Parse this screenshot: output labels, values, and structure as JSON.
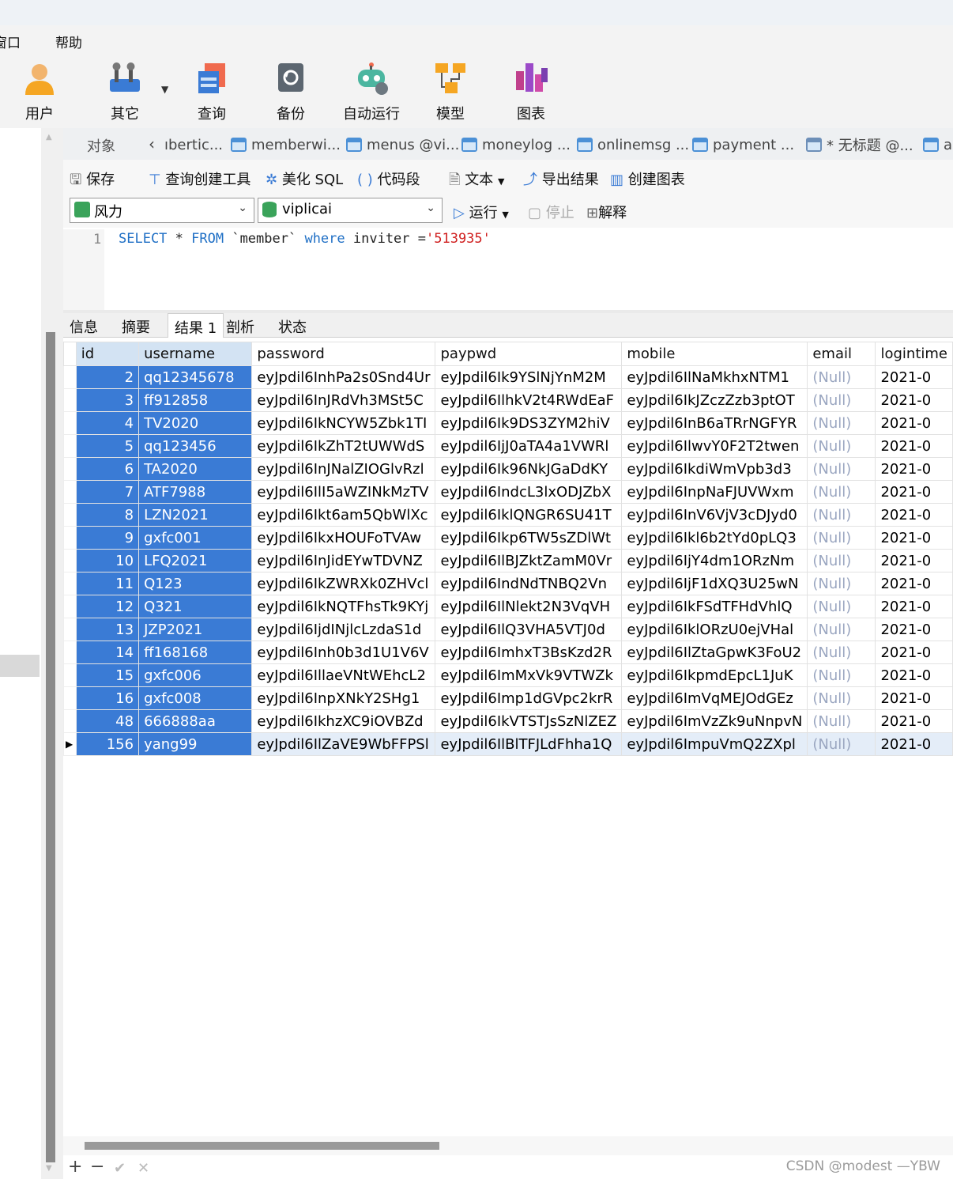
{
  "menu": {
    "window_partial": "窗口",
    "help": "帮助"
  },
  "ribbon": [
    {
      "label": "用户",
      "icon": "user-icon"
    },
    {
      "label": "其它",
      "icon": "tools-icon"
    },
    {
      "label": "查询",
      "icon": "query-icon"
    },
    {
      "label": "备份",
      "icon": "backup-icon"
    },
    {
      "label": "自动运行",
      "icon": "robot-icon"
    },
    {
      "label": "模型",
      "icon": "model-icon"
    },
    {
      "label": "图表",
      "icon": "chart-icon"
    }
  ],
  "tabs": {
    "objects": "对象",
    "items": [
      "ıbertic...",
      "memberwi...",
      "menus @vi...",
      "moneylog ...",
      "onlinemsg ...",
      "payment ...",
      "* 无标题 @...",
      "ac"
    ]
  },
  "toolbar1": {
    "save": "保存",
    "query_builder": "查询创建工具",
    "beautify": "美化 SQL",
    "snippet": "代码段",
    "text": "文本",
    "export": "导出结果",
    "create_chart": "创建图表"
  },
  "toolbar2": {
    "connection": "风力",
    "database": "viplicai",
    "run": "运行",
    "stop": "停止",
    "explain": "解释"
  },
  "editor": {
    "line": "1",
    "sql_select": "SELECT",
    "sql_star": " * ",
    "sql_from": "FROM",
    "sql_table": " `member` ",
    "sql_where": "where",
    "sql_cond": " inviter =",
    "sql_value": "'513935'"
  },
  "result_tabs": [
    "信息",
    "摘要",
    "结果 1",
    "剖析",
    "状态"
  ],
  "grid": {
    "columns": [
      "id",
      "username",
      "password",
      "paypwd",
      "mobile",
      "email",
      "logintime"
    ],
    "rows": [
      [
        "2",
        "qq12345678",
        "eyJpdil6InhPa2s0Snd4Ur",
        "eyJpdil6Ik9YSlNjYnM2M",
        "eyJpdil6IlNaMkhxNTM1",
        "(Null)",
        "2021-0"
      ],
      [
        "3",
        "ff912858",
        "eyJpdil6InJRdVh3MSt5C",
        "eyJpdil6IlhkV2t4RWdEaF",
        "eyJpdil6IkJZczZzb3ptOT",
        "(Null)",
        "2021-0"
      ],
      [
        "4",
        "TV2020",
        "eyJpdil6IkNCYW5Zbk1TI",
        "eyJpdil6Ik9DS3ZYM2hiV",
        "eyJpdil6InB6aTRrNGFYR",
        "(Null)",
        "2021-0"
      ],
      [
        "5",
        "qq123456",
        "eyJpdil6IkZhT2tUWWdS",
        "eyJpdil6IjJ0aTA4a1VWRl",
        "eyJpdil6IlwvY0F2T2twen",
        "(Null)",
        "2021-0"
      ],
      [
        "6",
        "TA2020",
        "eyJpdil6InJNalZIOGlvRzl",
        "eyJpdil6Ik96NkJGaDdKY",
        "eyJpdil6IkdiWmVpb3d3",
        "(Null)",
        "2021-0"
      ],
      [
        "7",
        "ATF7988",
        "eyJpdil6IlI5aWZINkMzTV",
        "eyJpdil6IndcL3lxODJZbX",
        "eyJpdil6InpNaFJUVWxm",
        "(Null)",
        "2021-0"
      ],
      [
        "8",
        "LZN2021",
        "eyJpdil6Ikt6am5QbWlXc",
        "eyJpdil6IklQNGR6SU41T",
        "eyJpdil6InV6VjV3cDJyd0",
        "(Null)",
        "2021-0"
      ],
      [
        "9",
        "gxfc001",
        "eyJpdil6IkxHOUFoTVAw",
        "eyJpdil6Ikp6TW5sZDlWt",
        "eyJpdil6Ikl6b2tYd0pLQ3",
        "(Null)",
        "2021-0"
      ],
      [
        "10",
        "LFQ2021",
        "eyJpdil6InJidEYwTDVNZ",
        "eyJpdil6IlBJZktZamM0Vr",
        "eyJpdil6IjY4dm1ORzNm",
        "(Null)",
        "2021-0"
      ],
      [
        "11",
        "Q123",
        "eyJpdil6IkZWRXk0ZHVcl",
        "eyJpdil6IndNdTNBQ2Vn",
        "eyJpdil6IjF1dXQ3U25wN",
        "(Null)",
        "2021-0"
      ],
      [
        "12",
        "Q321",
        "eyJpdil6IkNQTFhsTk9KYj",
        "eyJpdil6IlNlekt2N3VqVH",
        "eyJpdil6IkFSdTFHdVhlQ",
        "(Null)",
        "2021-0"
      ],
      [
        "13",
        "JZP2021",
        "eyJpdil6IjdINjlcLzdaS1d",
        "eyJpdil6IlQ3VHA5VTJ0d",
        "eyJpdil6IklORzU0ejVHal",
        "(Null)",
        "2021-0"
      ],
      [
        "14",
        "ff168168",
        "eyJpdil6Inh0b3d1U1V6V",
        "eyJpdil6ImhxT3BsKzd2R",
        "eyJpdil6IlZtaGpwK3FoU2",
        "(Null)",
        "2021-0"
      ],
      [
        "15",
        "gxfc006",
        "eyJpdil6IllaeVNtWEhcL2",
        "eyJpdil6ImMxVk9VTWZk",
        "eyJpdil6IkpmdEpcL1JuK",
        "(Null)",
        "2021-0"
      ],
      [
        "16",
        "gxfc008",
        "eyJpdil6InpXNkY2SHg1",
        "eyJpdil6Imp1dGVpc2krR",
        "eyJpdil6ImVqMEJOdGEz",
        "(Null)",
        "2021-0"
      ],
      [
        "48",
        "666888aa",
        "eyJpdil6IkhzXC9iOVBZd",
        "eyJpdil6IkVTSTJsSzNlZEZ",
        "eyJpdil6ImVzZk9uNnpvN",
        "(Null)",
        "2021-0"
      ],
      [
        "156",
        "yang99",
        "eyJpdil6IlZaVE9WbFFPSl",
        "eyJpdil6IlBlTFJLdFhha1Q",
        "eyJpdil6ImpuVmQ2ZXpl",
        "(Null)",
        "2021-0"
      ]
    ]
  },
  "bottom": {
    "add": "+",
    "remove": "−",
    "apply": "✔",
    "discard": "✕"
  },
  "watermark": "CSDN @modest —YBW",
  "colors": {
    "selection": "#3a7bd5",
    "null_text": "#9aa6c0",
    "keyword": "#1f6fc5",
    "string": "#d02020"
  }
}
